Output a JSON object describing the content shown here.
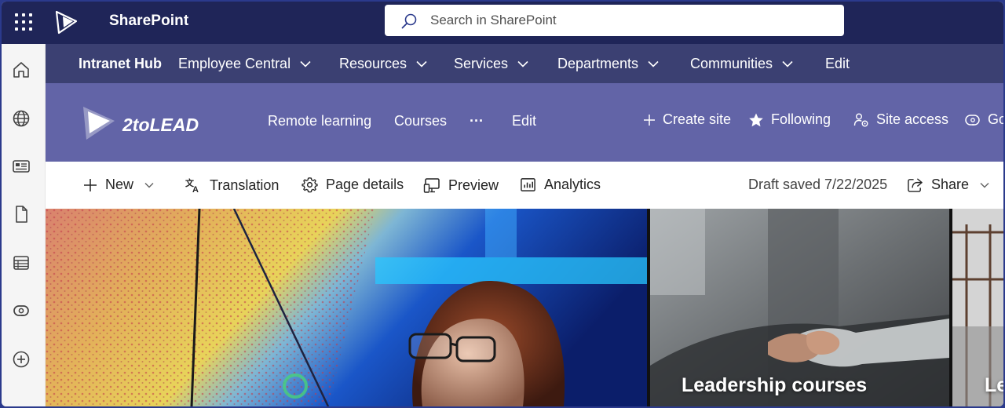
{
  "suite_bar": {
    "app_name": "SharePoint",
    "search_placeholder": "Search in SharePoint",
    "icons": [
      "app-launcher-icon",
      "sharepoint-logo-icon",
      "search-icon"
    ]
  },
  "left_rail": {
    "icons": [
      "home-icon",
      "globe-icon",
      "news-icon",
      "files-icon",
      "lists-icon",
      "loop-icon",
      "create-icon"
    ]
  },
  "hub_nav": {
    "title": "Intranet Hub",
    "items": [
      {
        "label": "Employee Central",
        "has_dropdown": true
      },
      {
        "label": "Resources",
        "has_dropdown": true
      },
      {
        "label": "Services",
        "has_dropdown": true
      },
      {
        "label": "Departments",
        "has_dropdown": true
      },
      {
        "label": "Communities",
        "has_dropdown": true
      },
      {
        "label": "Edit",
        "has_dropdown": false
      }
    ]
  },
  "site_header": {
    "logo_text": "2toLEAD",
    "nav": [
      {
        "label": "Remote learning"
      },
      {
        "label": "Courses"
      },
      {
        "label": "···"
      },
      {
        "label": "Edit"
      }
    ],
    "actions": [
      {
        "label": "Create site",
        "icon": "plus-icon"
      },
      {
        "label": "Following",
        "icon": "star-icon"
      },
      {
        "label": "Site access",
        "icon": "people-settings-icon"
      },
      {
        "label": "Go",
        "icon": "loop-icon"
      }
    ]
  },
  "command_bar": {
    "new_label": "New",
    "translation_label": "Translation",
    "page_details_label": "Page details",
    "preview_label": "Preview",
    "analytics_label": "Analytics",
    "draft_status": "Draft saved 7/22/2025",
    "share_label": "Share"
  },
  "hero": {
    "tiles": [
      {
        "caption": ""
      },
      {
        "caption": "Leadership courses"
      },
      {
        "caption": "Le"
      }
    ]
  },
  "colors": {
    "suite_bar": "#1f2558",
    "hub_nav": "#3b4072",
    "site_header": "#6264a7",
    "rail": "#f5f5f5"
  }
}
